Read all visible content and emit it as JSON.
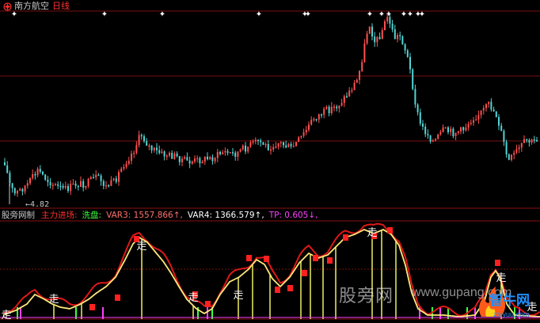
{
  "header": {
    "stock_name": "南方航空",
    "period": "日线"
  },
  "price_panel": {
    "low_label": "←4.82",
    "star_marker": "✦",
    "colors": {
      "up": "#ff5050",
      "down": "#54d4d4",
      "grid": "#7a1010",
      "background": "#000000"
    }
  },
  "indicator_panel": {
    "name": "股旁网制",
    "items": [
      {
        "label": "主力进场:",
        "color": "#ff3030"
      },
      {
        "label": "洗盘:",
        "color": "#40ff40"
      },
      {
        "label": "VAR3: 1557.866↑,",
        "color": "#ff7070"
      },
      {
        "label": "VAR4: 1366.579↑,",
        "color": "#ffffff"
      },
      {
        "label": "TP: 0.605↓,",
        "color": "#ff40ff"
      }
    ],
    "go_marker": "走"
  },
  "watermark": {
    "text": "股旁网",
    "url": "www.gupang.com",
    "logo_text": "智牛网",
    "logo_sub": "zaiyuu.com"
  }
}
